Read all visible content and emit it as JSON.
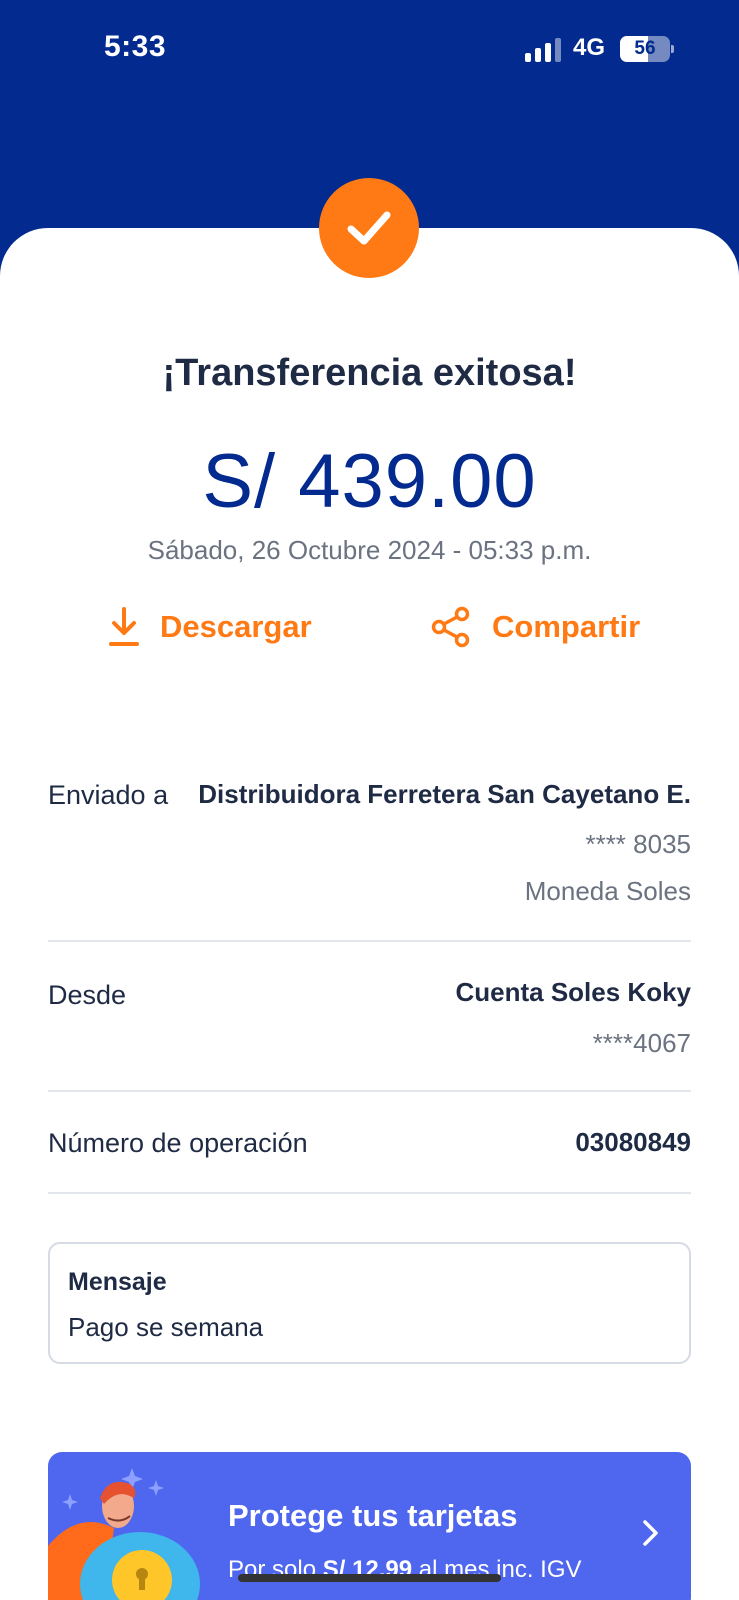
{
  "status_bar": {
    "time": "5:33",
    "network": "4G",
    "battery": "56",
    "battery_level": 0.56
  },
  "receipt": {
    "title": "¡Transferencia exitosa!",
    "amount": "S/ 439.00",
    "datetime": "Sábado, 26 Octubre 2024 - 05:33 p.m.",
    "download_label": "Descargar",
    "share_label": "Compartir"
  },
  "details": {
    "sent_to": {
      "label": "Enviado a",
      "name": "Distribuidora Ferretera San Cayetano E.",
      "account": "**** 8035",
      "currency": "Moneda Soles"
    },
    "from": {
      "label": "Desde",
      "account_name": "Cuenta Soles Koky",
      "account": "****4067"
    },
    "operation": {
      "label": "Número de operación",
      "number": "03080849"
    }
  },
  "message": {
    "title": "Mensaje",
    "text": "Pago se semana"
  },
  "promo": {
    "title": "Protege tus tarjetas",
    "subtitle_prefix": "Por solo ",
    "subtitle_price": "S/ 12.99",
    "subtitle_suffix": " al mes inc. IGV"
  },
  "colors": {
    "brand_blue": "#032a8e",
    "accent_orange": "#ff7a14",
    "promo_blue": "#4f67ee"
  },
  "icons": {
    "success": "check-icon",
    "download": "download-icon",
    "share": "share-icon",
    "promo_arrow": "chevron-right-icon"
  }
}
